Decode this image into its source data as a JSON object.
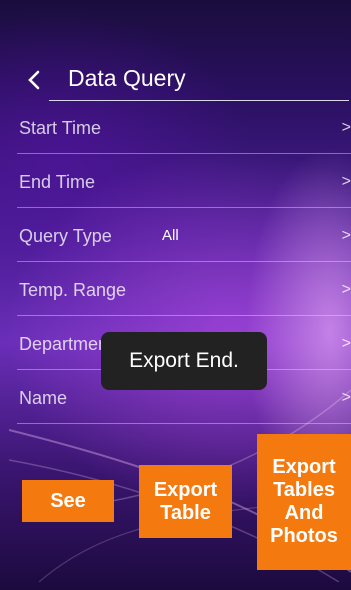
{
  "header": {
    "title": "Data Query",
    "back_icon": "chevron-left-icon"
  },
  "rows": [
    {
      "label": "Start Time",
      "value": ""
    },
    {
      "label": "End Time",
      "value": ""
    },
    {
      "label": "Query Type",
      "value": "All"
    },
    {
      "label": "Temp. Range",
      "value": ""
    },
    {
      "label": "Department",
      "value": ""
    },
    {
      "label": "Name",
      "value": ""
    }
  ],
  "row_chevron": ">",
  "toast": {
    "text": "Export End."
  },
  "buttons": {
    "see": "See",
    "export_table": "Export\nTable",
    "export_tables_photos": "Export\nTables\nAnd\nPhotos"
  },
  "colors": {
    "button": "#f47a10",
    "toast": "#222222"
  }
}
